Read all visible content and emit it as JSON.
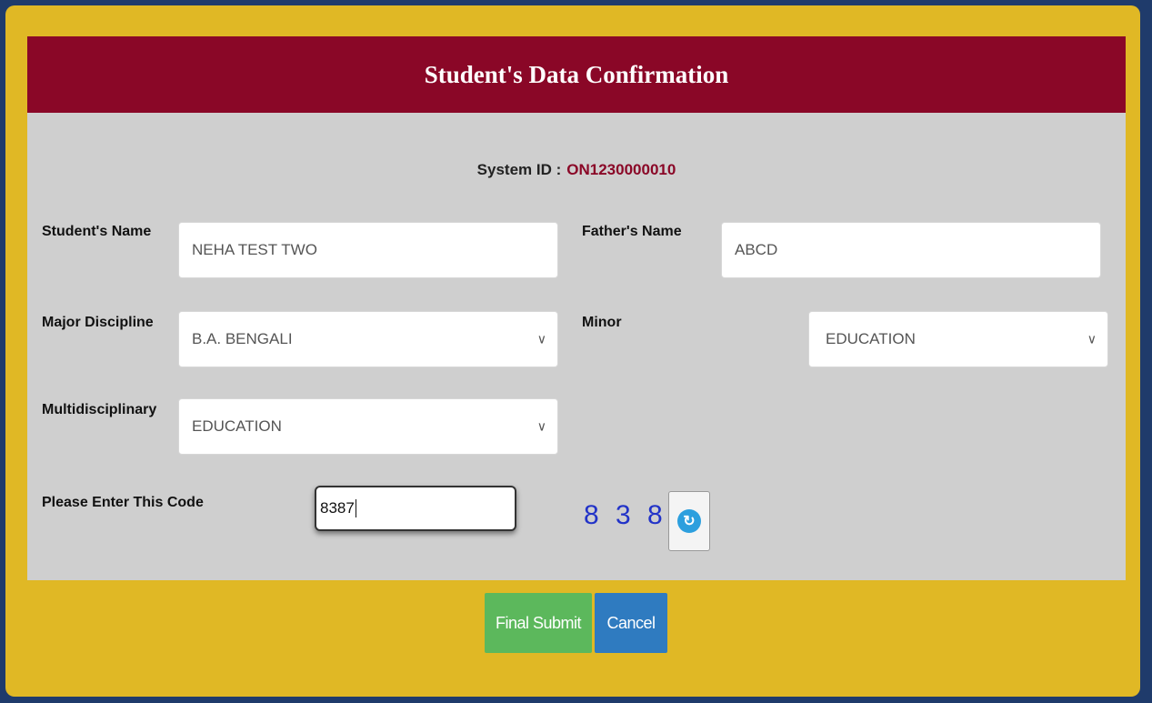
{
  "header": {
    "title": "Student's Data Confirmation"
  },
  "system_id": {
    "label": "System ID :",
    "value": "ON1230000010"
  },
  "fields": {
    "student_name": {
      "label": "Student's Name",
      "value": "NEHA TEST TWO"
    },
    "father_name": {
      "label": "Father's Name",
      "value": "ABCD"
    },
    "major": {
      "label": "Major Discipline",
      "value": "B.A. BENGALI"
    },
    "minor": {
      "label": "Minor",
      "value": "EDUCATION"
    },
    "multidisciplinary": {
      "label": "Multidisciplinary",
      "value": "EDUCATION"
    }
  },
  "captcha": {
    "label": "Please Enter This Code",
    "input_value": "8387",
    "code": "8 3 8 7"
  },
  "buttons": {
    "submit": "Final Submit",
    "cancel": "Cancel"
  },
  "colors": {
    "header": "#8a0727",
    "frame": "#e0b825",
    "submit": "#5cb85c",
    "cancel": "#2f7bc0",
    "captcha": "#2233c8"
  },
  "icons": {
    "dropdown": "chevron-down-icon",
    "refresh": "refresh-icon"
  }
}
